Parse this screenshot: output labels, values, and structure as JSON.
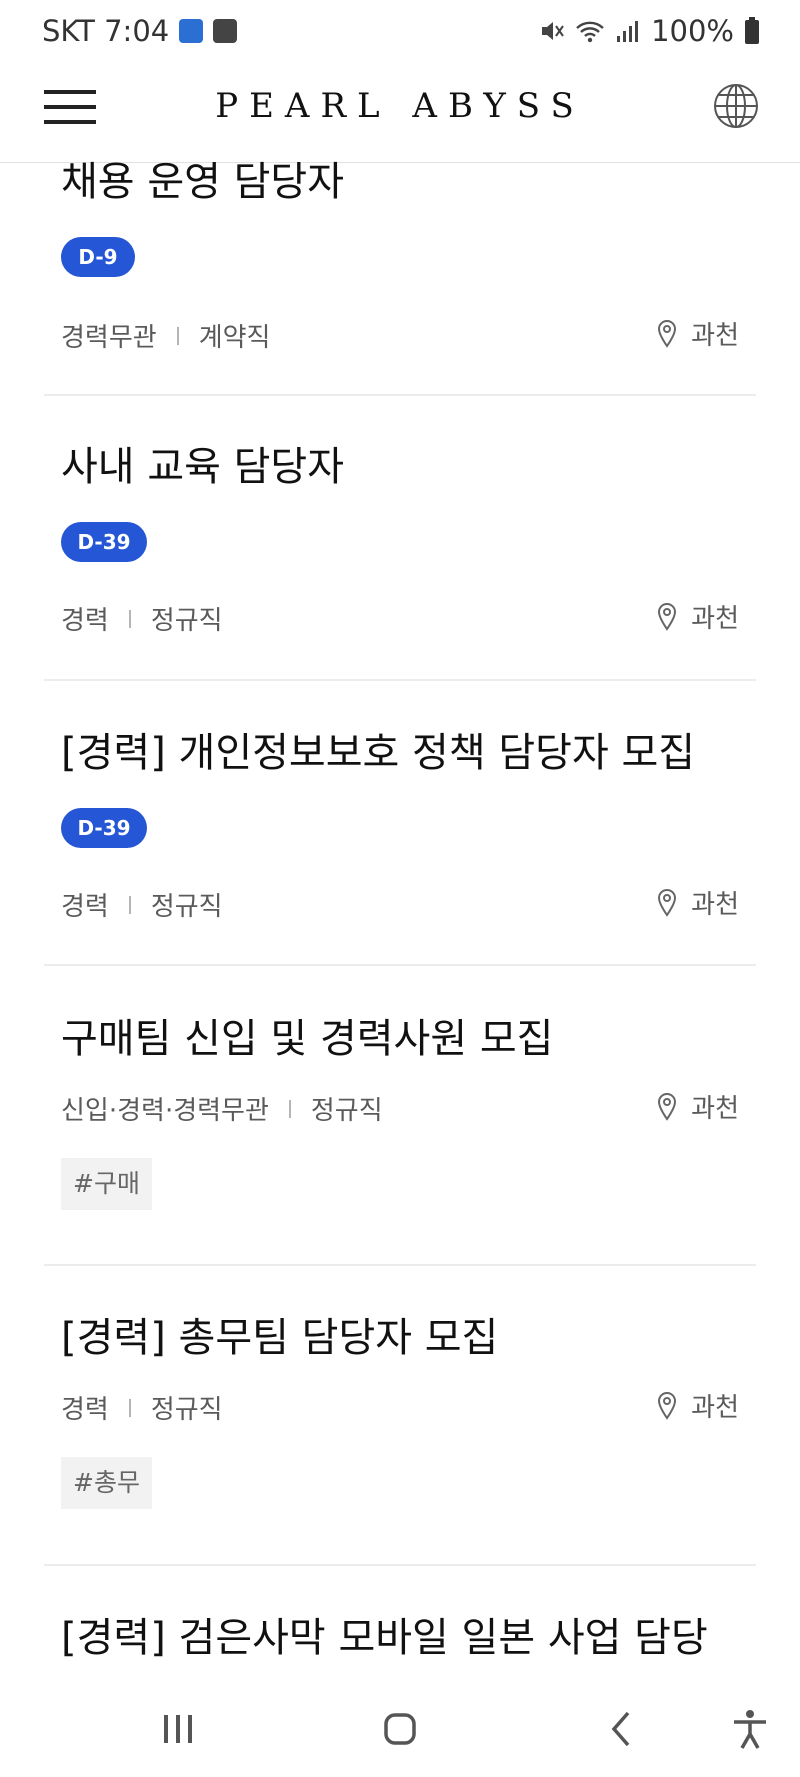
{
  "status_bar": {
    "carrier_time": "SKT 7:04",
    "battery": "100%"
  },
  "header": {
    "logo": "PEARL ABYSS"
  },
  "jobs": [
    {
      "title": "채용 운영 담당자",
      "badge": "D-9",
      "experience": "경력무관",
      "employment": "계약직",
      "location": "과천"
    },
    {
      "title": "사내 교육 담당자",
      "badge": "D-39",
      "experience": "경력",
      "employment": "정규직",
      "location": "과천"
    },
    {
      "title": "[경력] 개인정보보호 정책 담당자 모집",
      "badge": "D-39",
      "experience": "경력",
      "employment": "정규직",
      "location": "과천"
    },
    {
      "title": "구매팀 신입 및 경력사원 모집",
      "experience": "신입·경력·경력무관",
      "employment": "정규직",
      "location": "과천",
      "tag": "#구매"
    },
    {
      "title": "[경력] 총무팀 담당자 모집",
      "experience": "경력",
      "employment": "정규직",
      "location": "과천",
      "tag": "#총무"
    },
    {
      "title": "[경력] 검은사막 모바일 일본 사업 담당"
    }
  ],
  "colors": {
    "badge": "#2456d6",
    "divider": "#ececec",
    "meta_text": "#5a5a5a"
  }
}
